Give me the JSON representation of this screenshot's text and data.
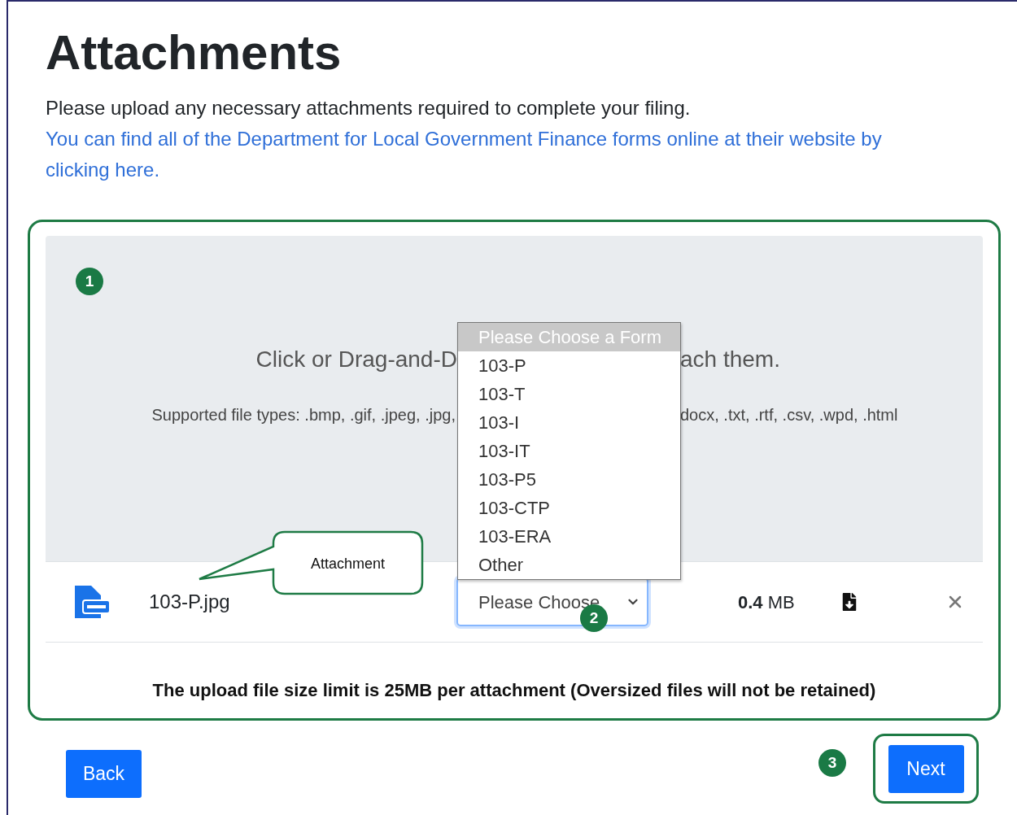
{
  "page": {
    "title": "Attachments",
    "intro": "Please upload any necessary attachments required to complete your filing.",
    "link": "You can find all of the Department for Local Government Finance forms online at their website by clicking here."
  },
  "upload": {
    "badge": "1",
    "prompt_left": "Click or Drag-and-D",
    "prompt_right": "ach them.",
    "types_left": "Supported file types: .bmp, .gif, .jpeg, .jpg,",
    "types_right": "docx, .txt, .rtf, .csv, .wpd, .html"
  },
  "file": {
    "name": "103-P.jpg",
    "form_select": {
      "value": "Please Choose",
      "badge": "2"
    },
    "size_value": "0.4",
    "size_unit": "MB"
  },
  "callout": "Attachment",
  "dropdown": {
    "options": [
      {
        "label": "Please Choose a Form",
        "selected": true
      },
      {
        "label": "103-P",
        "selected": false
      },
      {
        "label": "103-T",
        "selected": false
      },
      {
        "label": "103-I",
        "selected": false
      },
      {
        "label": "103-IT",
        "selected": false
      },
      {
        "label": "103-P5",
        "selected": false
      },
      {
        "label": "103-CTP",
        "selected": false
      },
      {
        "label": "103-ERA",
        "selected": false
      },
      {
        "label": "Other",
        "selected": false
      }
    ]
  },
  "size_limit_note": "The upload file size limit is 25MB per attachment (Oversized files will not be retained)",
  "buttons": {
    "back": "Back",
    "next": "Next",
    "next_badge": "3"
  }
}
